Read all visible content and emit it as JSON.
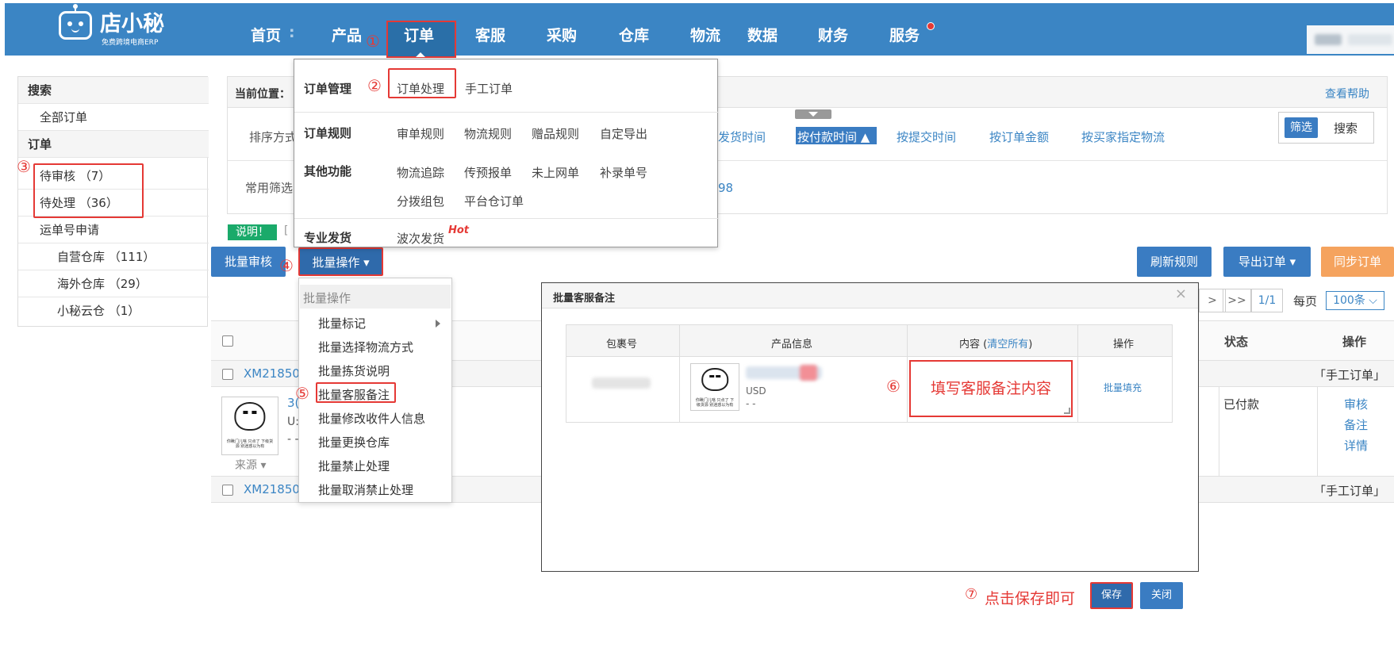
{
  "nav": {
    "logo_name": "店小秘",
    "logo_sub": "免费跨境电商ERP",
    "items": [
      "首页",
      "产品",
      "订单",
      "客服",
      "采购",
      "仓库",
      "物流",
      "数据",
      "财务",
      "服务"
    ]
  },
  "sidebar": {
    "search_head": "搜索",
    "all_orders": "全部订单",
    "orders_head": "订单",
    "pending_review": "待审核 （7）",
    "pending_process": "待处理 （36）",
    "waybill_apply": "运单号申请",
    "self_warehouse": "自营仓库 （111）",
    "overseas_warehouse": "海外仓库 （29）",
    "xiaomi_cloud": "小秘云仓 （1）"
  },
  "crumb": {
    "label": "当前位置：",
    "help": "查看帮助"
  },
  "filter": {
    "sort_label": "排序方式",
    "common_label": "常用筛选",
    "sort_links": [
      "发货时间",
      "按付款时间 ▲",
      "按提交时间",
      "按订单金额",
      "按买家指定物流"
    ],
    "partial_count": "98",
    "filter_btn": "筛选",
    "search_btn": "搜索"
  },
  "notice": {
    "badge": "说明！"
  },
  "actions": {
    "batch_review": "批量审核",
    "batch_ops": "批量操作 ▾",
    "refresh_rules": "刷新规则",
    "export_orders": "导出订单 ▾",
    "sync_orders": "同步订单"
  },
  "mega_menu": {
    "order_mgmt": "订单管理",
    "order_process": "订单处理",
    "manual_order": "手工订单",
    "order_rules": "订单规则",
    "rules": [
      "审单规则",
      "物流规则",
      "赠品规则",
      "自定导出"
    ],
    "other": "其他功能",
    "other_items": [
      "物流追踪",
      "传预报单",
      "未上网单",
      "补录单号"
    ],
    "other_items2": [
      "分拨组包",
      "平台仓订单"
    ],
    "pro_ship": "专业发货",
    "wave_ship": "波次发货",
    "hot": "Hot"
  },
  "batch_menu": {
    "title": "批量操作",
    "items": [
      "批量标记",
      "批量选择物流方式",
      "批量拣货说明",
      "批量客服备注",
      "批量修改收件人信息",
      "批量更换仓库",
      "批量禁止处理",
      "批量取消禁止处理"
    ]
  },
  "pager": {
    "next": ">",
    "last": ">>",
    "page": "1/1",
    "per_page": "每页",
    "per_value": "100条 ⌵"
  },
  "table": {
    "status_head": "状态",
    "op_head": "操作",
    "order_no_1": "XM21850",
    "order_no_2": "XM21850",
    "manual_tag": "「手工订单」",
    "partial_title": "3(",
    "partial_currency": "U:",
    "partial_dash": "- -",
    "source": "来源 ▾",
    "status": "已付款",
    "ops": [
      "审核",
      "备注",
      "详情"
    ]
  },
  "thumb_caption": "你瞅门儿啥 只点了 下级货源 别迷惑以为有",
  "modal": {
    "title": "批量客服备注",
    "close": "×",
    "col_package": "包裹号",
    "col_product": "产品信息",
    "col_content": "内容 (",
    "clear_all": "清空所有",
    "col_content_end": ")",
    "col_op": "操作",
    "currency": "USD",
    "dash": "- -",
    "fill_all": "批量填充",
    "save": "保存",
    "close_btn": "关闭"
  },
  "annotations": {
    "n1": "①",
    "n2": "②",
    "n3": "③",
    "n4": "④",
    "n5": "⑤",
    "n6": "⑥",
    "n7": "⑦",
    "remark_hint": "填写客服备注内容",
    "save_hint": "点击保存即可"
  },
  "colors": {
    "primary": "#3b85c4",
    "accent_red": "#e53935",
    "orange": "#f5a35e",
    "green_badge": "#1aaa6a"
  }
}
